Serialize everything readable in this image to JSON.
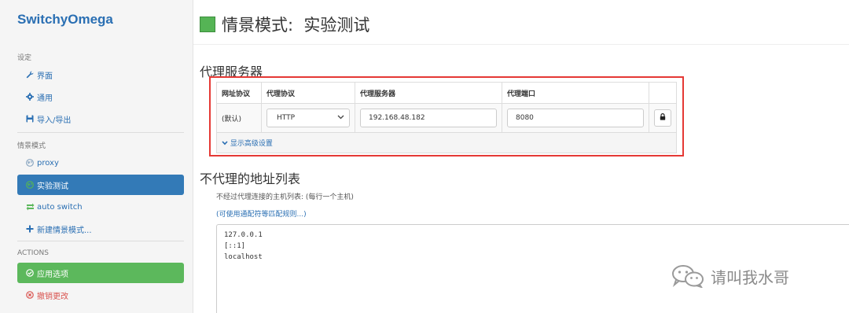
{
  "sidebar": {
    "brand": "SwitchyOmega",
    "settings_header": "设定",
    "settings_items": [
      {
        "icon": "wrench-icon",
        "label": "界面"
      },
      {
        "icon": "gear-icon",
        "label": "通用"
      },
      {
        "icon": "save-icon",
        "label": "导入/导出"
      }
    ],
    "profiles_header": "情景模式",
    "profiles": [
      {
        "icon": "globe-icon",
        "label": "proxy",
        "active": false
      },
      {
        "icon": "globe-icon",
        "label": "实验测试",
        "active": true
      },
      {
        "icon": "switch-icon",
        "label": "auto switch",
        "active": false
      }
    ],
    "new_profile": "新建情景模式...",
    "actions_header": "ACTIONS",
    "apply": "应用选项",
    "discard": "撤销更改"
  },
  "main": {
    "title": "情景模式:  实验测试",
    "profile_color": "#55b455",
    "proxy_section": "代理服务器",
    "table": {
      "headers": [
        "网址协议",
        "代理协议",
        "代理服务器",
        "代理端口"
      ],
      "row": {
        "scheme": "(默认)",
        "protocol": "HTTP",
        "server": "192.168.48.182",
        "port": "8080"
      },
      "advanced_link": "显示高级设置"
    },
    "bypass_section": "不代理的地址列表",
    "bypass_help": "不经过代理连接的主机列表: (每行一个主机)",
    "bypass_wildcard_link": "(可使用通配符等匹配规则...)",
    "bypass_list": "127.0.0.1\n[::1]\nlocalhost"
  },
  "watermark": "请叫我水哥"
}
